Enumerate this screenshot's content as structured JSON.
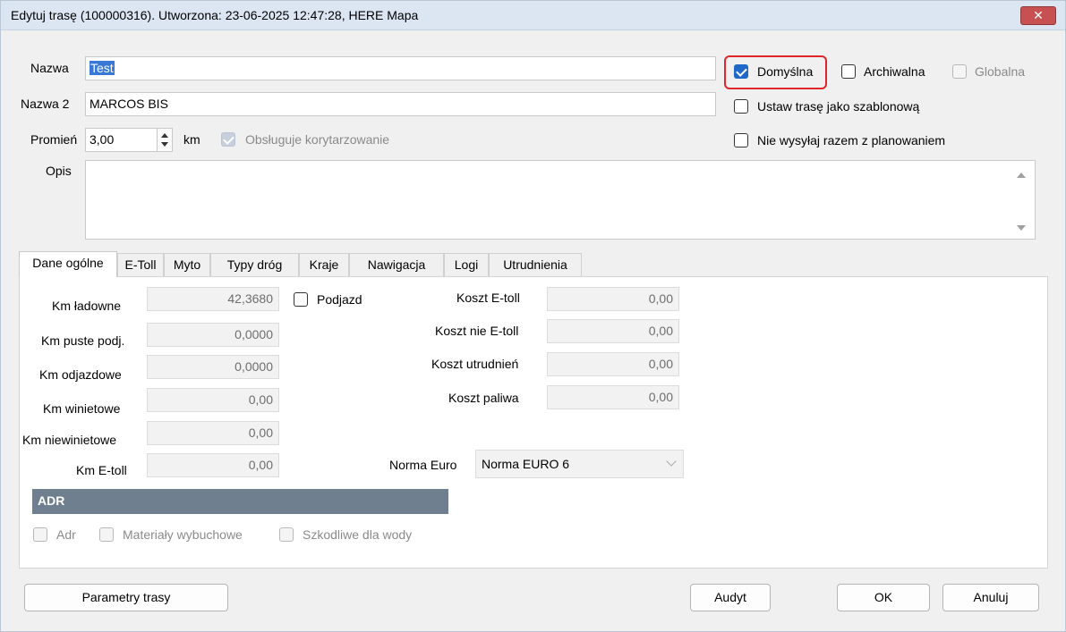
{
  "window": {
    "title": "Edytuj trasę (100000316). Utworzona: 23-06-2025 12:47:28, HERE Mapa",
    "close_label": "✕"
  },
  "form": {
    "nazwa_label": "Nazwa",
    "nazwa_value": "Test",
    "nazwa2_label": "Nazwa 2",
    "nazwa2_value": "MARCOS BIS",
    "promien_label": "Promień",
    "promien_value": "3,00",
    "promien_unit": "km",
    "korytarz_label": "Obsługuje korytarzowanie",
    "opis_label": "Opis",
    "opis_value": ""
  },
  "options": {
    "domyslna": {
      "label": "Domyślna",
      "checked": true
    },
    "archiwalna": {
      "label": "Archiwalna",
      "checked": false
    },
    "globalna": {
      "label": "Globalna",
      "checked": false,
      "disabled": true
    },
    "szablon": {
      "label": "Ustaw trasę jako szablonową",
      "checked": false
    },
    "nie_wysylaj": {
      "label": "Nie wysyłaj razem z planowaniem",
      "checked": false
    }
  },
  "tabs": [
    {
      "label": "Dane ogólne",
      "active": true
    },
    {
      "label": "E-Toll"
    },
    {
      "label": "Myto"
    },
    {
      "label": "Typy dróg"
    },
    {
      "label": "Kraje"
    },
    {
      "label": "Nawigacja"
    },
    {
      "label": "Logi"
    },
    {
      "label": "Utrudnienia"
    }
  ],
  "general": {
    "km_ladowne": {
      "label": "Km ładowne",
      "value": "42,3680"
    },
    "podjazd": {
      "label": "Podjazd",
      "checked": false
    },
    "km_puste": {
      "label": "Km puste podj.",
      "value": "0,0000"
    },
    "km_odjazdowe": {
      "label": "Km odjazdowe",
      "value": "0,0000"
    },
    "km_winietowe": {
      "label": "Km winietowe",
      "value": "0,00"
    },
    "km_niewinietowe": {
      "label": "Km niewinietowe",
      "value": "0,00"
    },
    "km_etoll": {
      "label": "Km E-toll",
      "value": "0,00"
    },
    "koszt_etoll": {
      "label": "Koszt E-toll",
      "value": "0,00"
    },
    "koszt_nie_etoll": {
      "label": "Koszt nie E-toll",
      "value": "0,00"
    },
    "koszt_utrudnien": {
      "label": "Koszt utrudnień",
      "value": "0,00"
    },
    "koszt_paliwa": {
      "label": "Koszt paliwa",
      "value": "0,00"
    },
    "norma_euro": {
      "label": "Norma Euro",
      "value": "Norma EURO 6"
    }
  },
  "adr": {
    "header": "ADR",
    "adr": {
      "label": "Adr",
      "checked": false
    },
    "wybuchowe": {
      "label": "Materiały wybuchowe",
      "checked": false
    },
    "woda": {
      "label": "Szkodliwe dla wody",
      "checked": false
    }
  },
  "buttons": {
    "parametry": "Parametry trasy",
    "audyt": "Audyt",
    "ok": "OK",
    "anuluj": "Anuluj"
  }
}
